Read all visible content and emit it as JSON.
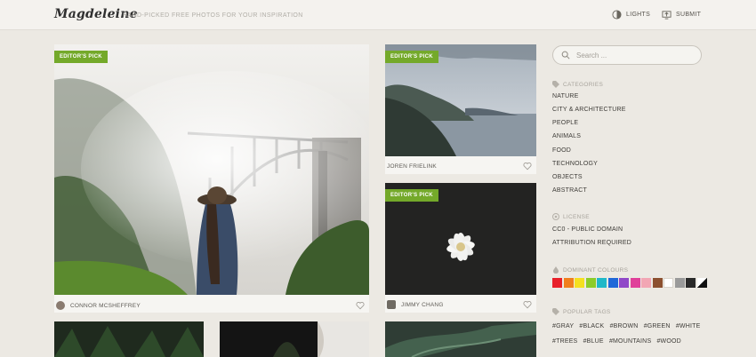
{
  "header": {
    "logo": "Magdeleine",
    "tagline": "HAND-PICKED FREE PHOTOS FOR YOUR INSPIRATION",
    "lights_label": "LIGHTS",
    "submit_label": "SUBMIT"
  },
  "cards": [
    {
      "badge": "EDITOR'S PICK",
      "author": "CONNOR MCSHEFFREY"
    },
    {
      "badge": "EDITOR'S PICK",
      "author": "JOREN FRIELINK"
    },
    {
      "badge": "EDITOR'S PICK",
      "author": "JIMMY CHANG"
    }
  ],
  "search": {
    "placeholder": "Search ..."
  },
  "sidebar": {
    "categories_title": "CATEGORIES",
    "categories": [
      "NATURE",
      "CITY & ARCHITECTURE",
      "PEOPLE",
      "ANIMALS",
      "FOOD",
      "TECHNOLOGY",
      "OBJECTS",
      "ABSTRACT"
    ],
    "license_title": "LICENSE",
    "licenses": [
      "CC0 - PUBLIC DOMAIN",
      "ATTRIBUTION REQUIRED"
    ],
    "colours_title": "DOMINANT COLOURS",
    "colours": [
      "#e8202a",
      "#f07f1e",
      "#f5e020",
      "#8ccc2a",
      "#20b8c8",
      "#2068d8",
      "#9048c8",
      "#e0409a",
      "#f2a6b4",
      "#8c5030",
      "#ffffff",
      "#9a9a9a",
      "#2a2a2a",
      "bw"
    ],
    "tags_title": "POPULAR TAGS",
    "tags_row1": [
      "#GRAY",
      "#BLACK",
      "#BROWN",
      "#GREEN",
      "#WHITE"
    ],
    "tags_row2": [
      "#TREES",
      "#BLUE",
      "#MOUNTAINS",
      "#WOOD"
    ]
  },
  "accent": "#74a92a"
}
